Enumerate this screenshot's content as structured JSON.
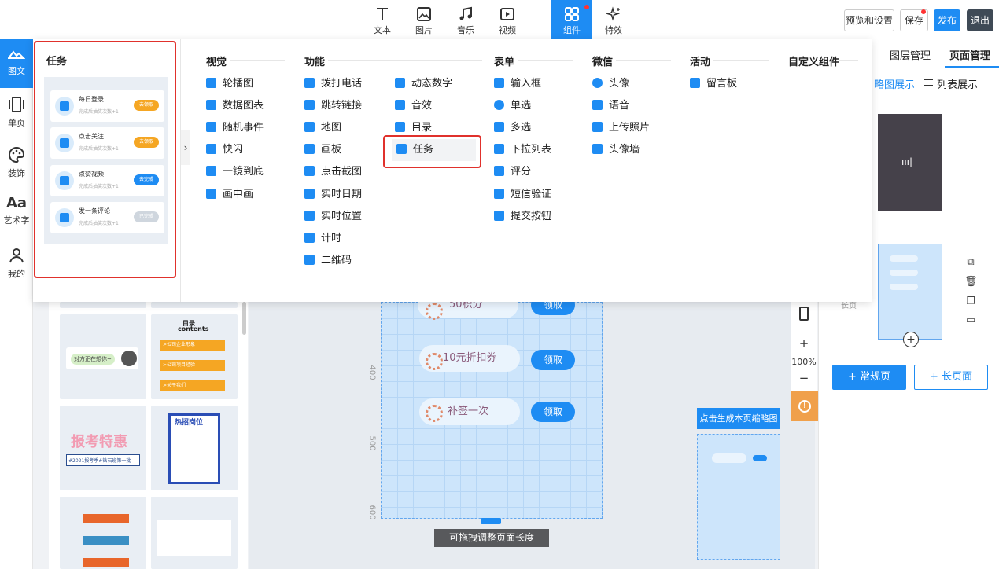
{
  "toolbar": {
    "items": [
      {
        "label": "文本",
        "icon": "text-icon"
      },
      {
        "label": "图片",
        "icon": "image-icon"
      },
      {
        "label": "音乐",
        "icon": "music-icon"
      },
      {
        "label": "视频",
        "icon": "video-icon"
      },
      {
        "label": "组件",
        "icon": "component-icon"
      },
      {
        "label": "特效",
        "icon": "sparkle-icon"
      }
    ],
    "preview": "预览和设置",
    "save": "保存",
    "publish": "发布",
    "exit": "退出"
  },
  "leftnav": [
    {
      "label": "图文"
    },
    {
      "label": "单页"
    },
    {
      "label": "装饰"
    },
    {
      "label": "艺术字"
    },
    {
      "label": "我的"
    }
  ],
  "task_panel": {
    "title": "任务",
    "items": [
      {
        "title": "每日登录",
        "sub": "完成后抽奖次数+1",
        "btn": "去领取",
        "btn_color": "#f5a623"
      },
      {
        "title": "点击关注",
        "sub": "完成后抽奖次数+1",
        "btn": "去领取",
        "btn_color": "#f5a623"
      },
      {
        "title": "点赞视频",
        "sub": "完成后抽奖次数+1",
        "btn": "去完成",
        "btn_color": "#1e8cf3"
      },
      {
        "title": "发一条评论",
        "sub": "完成后抽奖次数+1",
        "btn": "已完成",
        "btn_color": "#cfd6de"
      }
    ]
  },
  "menu": {
    "visual": {
      "title": "视觉",
      "items": [
        "轮播图",
        "数据图表",
        "随机事件",
        "快闪",
        "一镜到底",
        "画中画"
      ]
    },
    "function": {
      "title": "功能",
      "col1": [
        "拨打电话",
        "跳转链接",
        "地图",
        "画板",
        "点击截图",
        "实时日期",
        "实时位置",
        "计时",
        "二维码"
      ],
      "col2": [
        "动态数字",
        "音效",
        "目录",
        "任务"
      ]
    },
    "form": {
      "title": "表单",
      "items": [
        "输入框",
        "单选",
        "多选",
        "下拉列表",
        "评分",
        "短信验证",
        "提交按钮"
      ]
    },
    "wechat": {
      "title": "微信",
      "items": [
        "头像",
        "语音",
        "上传照片",
        "头像墙"
      ]
    },
    "activity": {
      "title": "活动",
      "items": [
        "留言板"
      ]
    },
    "custom": {
      "title": "自定义组件"
    }
  },
  "canvas": {
    "rewards": [
      {
        "label": "50积分",
        "btn": "领取"
      },
      {
        "label": "10元折扣券",
        "btn": "领取"
      },
      {
        "label": "补签一次",
        "btn": "领取"
      }
    ],
    "ruler": [
      "400",
      "500",
      "600"
    ],
    "drag_hint": "可拖拽调整页面长度",
    "zoom": "100%",
    "thumb_button": "点击生成本页缩略图"
  },
  "templates": {
    "contents_title": "目录",
    "contents_sub": "contents",
    "contents_items": [
      ">公司企业形象",
      ">公司项目经验",
      ">关于我们"
    ],
    "exam_title": "报考特惠",
    "exam_sub": "#2021报考季#钻石班第一批",
    "job_title": "热招岗位",
    "chat_text": "对方正在想你~"
  },
  "rightpanel": {
    "tab_layers": "图层管理",
    "tab_pages": "页面管理",
    "view_thumb": "略图展示",
    "view_list": "列表展示",
    "long_label": "长页",
    "btn_normal": "+ 常规页",
    "btn_long": "+ 长页面"
  },
  "colors": {
    "accent": "#1e8cf3",
    "highlight": "#e0312c"
  }
}
